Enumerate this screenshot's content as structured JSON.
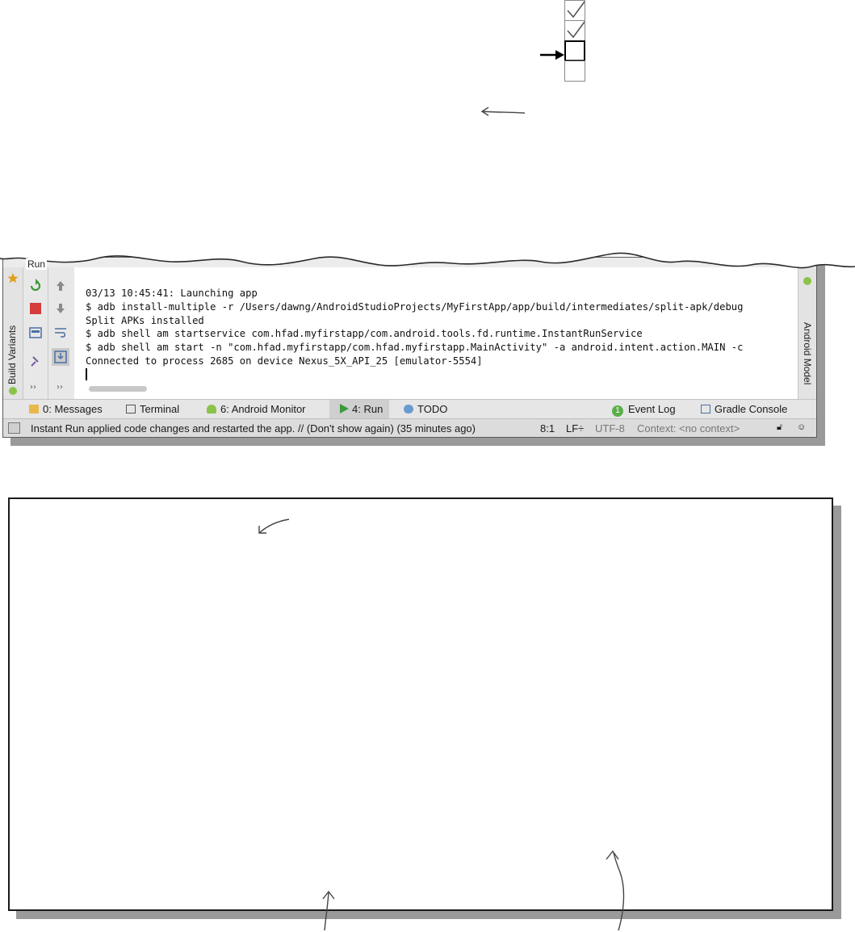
{
  "ide": {
    "run_label": "Run",
    "left_rail_label": "Build Variants",
    "right_rail_label": "Android Model",
    "console_lines": [
      "03/13 10:45:41: Launching app",
      "$ adb install-multiple -r /Users/dawng/AndroidStudioProjects/MyFirstApp/app/build/intermediates/split-apk/debug",
      "Split APKs installed",
      "$ adb shell am startservice com.hfad.myfirstapp/com.android.tools.fd.runtime.InstantRunService",
      "$ adb shell am start -n \"com.hfad.myfirstapp/com.hfad.myfirstapp.MainActivity\" -a android.intent.action.MAIN -c",
      "Connected to process 2685 on device Nexus_5X_API_25 [emulator-5554]"
    ],
    "more_glyph": "››",
    "tabs": {
      "messages": "0: Messages",
      "terminal": "Terminal",
      "android_monitor": "6: Android Monitor",
      "run": "4: Run",
      "todo": "TODO",
      "event_log": "Event Log",
      "event_log_badge": "1",
      "gradle_console": "Gradle Console"
    },
    "status": {
      "message": "Instant Run applied code changes and restarted the app. // (Don't show again) (35 minutes ago)",
      "position": "8:1",
      "line_ending": "LF÷",
      "encoding": "UTF-8",
      "context": "Context: <no context>"
    }
  },
  "checklist": {
    "checked_count": 2,
    "total": 4,
    "current_index": 2
  }
}
